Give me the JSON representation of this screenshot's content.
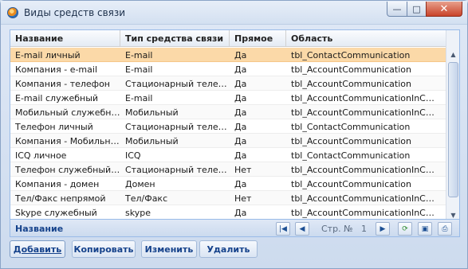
{
  "window": {
    "title": "Виды средств связи",
    "controls": {
      "minimize": "—",
      "maximize": "□",
      "close": "✕"
    }
  },
  "grid": {
    "columns": [
      "Название",
      "Тип средства связи",
      "Прямое",
      "Область"
    ],
    "rows": [
      [
        "E-mail личный",
        "E-mail",
        "Да",
        "tbl_ContactCommunication"
      ],
      [
        "Компания - e-mail",
        "E-mail",
        "Да",
        "tbl_AccountCommunication"
      ],
      [
        "Компания - телефон",
        "Стационарный телефон",
        "Да",
        "tbl_AccountCommunication"
      ],
      [
        "E-mail служебный",
        "E-mail",
        "Да",
        "tbl_AccountCommunicationInCont"
      ],
      [
        "Мобильный служебный",
        "Мобильный",
        "Да",
        "tbl_AccountCommunicationInCont"
      ],
      [
        "Телефон личный",
        "Стационарный телефон",
        "Да",
        "tbl_ContactCommunication"
      ],
      [
        "Компания - Мобильный",
        "Мобильный",
        "Да",
        "tbl_AccountCommunication"
      ],
      [
        "ICQ личное",
        "ICQ",
        "Да",
        "tbl_ContactCommunication"
      ],
      [
        "Телефон служебный ...",
        "Стационарный телефон",
        "Нет",
        "tbl_AccountCommunicationInCont"
      ],
      [
        "Компания - домен",
        "Домен",
        "Да",
        "tbl_AccountCommunication"
      ],
      [
        "Тел/Факс непрямой",
        "Тел/Факс",
        "Нет",
        "tbl_AccountCommunicationInCont"
      ],
      [
        "Skype служебный",
        "skype",
        "Да",
        "tbl_AccountCommunicationInCont"
      ]
    ],
    "selected_row_index": 0
  },
  "footer": {
    "label": "Название",
    "page_label": "Стр. №",
    "page_number": "1"
  },
  "actions": {
    "add": "Добавить",
    "copy": "Копировать",
    "edit": "Изменить",
    "delete": "Удалить"
  },
  "colors": {
    "selection": "#fbd9a8",
    "header_text": "#15428b",
    "border": "#99bbe8"
  }
}
